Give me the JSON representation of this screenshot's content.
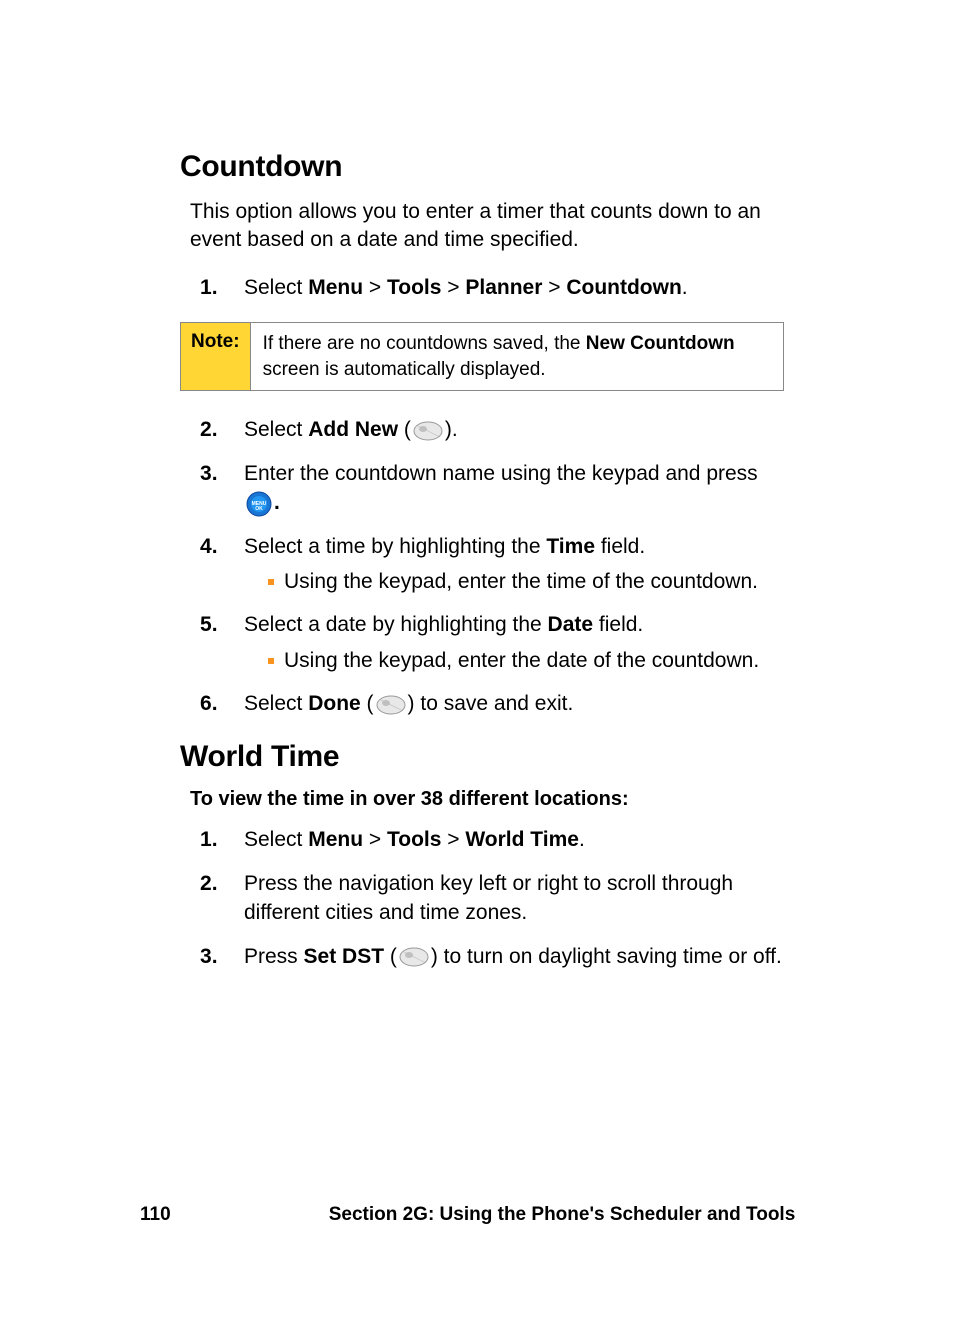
{
  "countdown": {
    "heading": "Countdown",
    "intro": "This option allows you to enter a timer that counts down to an event based on a date and time specified.",
    "step1_prefix": "Select ",
    "menu": "Menu",
    "sep": " > ",
    "tools": "Tools",
    "planner": "Planner",
    "countdown_label": "Countdown",
    "step1_suffix": ".",
    "note_label": "Note:",
    "note_text_a": "If there are no countdowns saved, the ",
    "note_bold": "New Countdown",
    "note_text_b": " screen is automatically displayed.",
    "step2_prefix": "Select ",
    "step2_bold": "Add New",
    "step2_paren_open": " (",
    "step2_paren_close": ").",
    "step3_a": "Enter the countdown name using the keypad and press ",
    "step3_b": ".",
    "step4_a": "Select a time by highlighting the ",
    "step4_bold": "Time",
    "step4_b": " field.",
    "step4_sub": "Using the keypad, enter the time of the countdown.",
    "step5_a": "Select a date by highlighting the ",
    "step5_bold": "Date",
    "step5_b": " field.",
    "step5_sub": "Using the keypad, enter the date of the countdown.",
    "step6_a": "Select ",
    "step6_bold": "Done",
    "step6_paren_open": " (",
    "step6_b": ") to save and exit."
  },
  "world_time": {
    "heading": "World Time",
    "subheading": "To view the time in over 38 different locations:",
    "step1_prefix": "Select ",
    "menu": "Menu",
    "sep": " > ",
    "tools": "Tools",
    "world_time_label": "World Time",
    "step1_suffix": ".",
    "step2": "Press the navigation key left or right to scroll through different cities and time zones.",
    "step3_a": "Press ",
    "step3_bold": "Set DST",
    "step3_paren_open": " (",
    "step3_b": ") to turn on daylight saving time or off."
  },
  "footer": {
    "page": "110",
    "section": "Section 2G: Using the Phone's Scheduler and Tools"
  }
}
